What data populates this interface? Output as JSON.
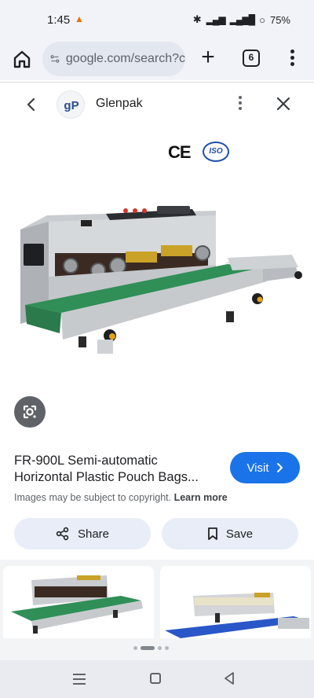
{
  "status": {
    "time": "1:45",
    "battery": "75%"
  },
  "browser": {
    "url": "google.com/search?c",
    "tab_count": "6"
  },
  "viewer": {
    "site_name": "Glenpak",
    "logo_text": "gP"
  },
  "image": {
    "cert_ce": "CE",
    "cert_iso": "ISO"
  },
  "result": {
    "title_line1": "FR-900L Semi-automatic",
    "title_line2": "Horizontal Plastic Pouch Bags...",
    "visit_label": "Visit",
    "copyright_text": "Images may be subject to copyright.",
    "learn_more": "Learn more",
    "share_label": "Share",
    "save_label": "Save"
  },
  "colors": {
    "accent": "#1a73e8",
    "chip_bg": "#e8edf7",
    "conveyor_green": "#2f8f57",
    "conveyor_blue": "#2a57c8"
  },
  "icons": [
    "home-icon",
    "plus-icon",
    "tabs-icon",
    "more-vert-icon",
    "back-arrow-icon",
    "close-icon",
    "lens-icon",
    "chevron-right-icon",
    "share-icon",
    "bookmark-icon",
    "nav-recents-icon",
    "nav-home-icon",
    "nav-back-icon"
  ]
}
